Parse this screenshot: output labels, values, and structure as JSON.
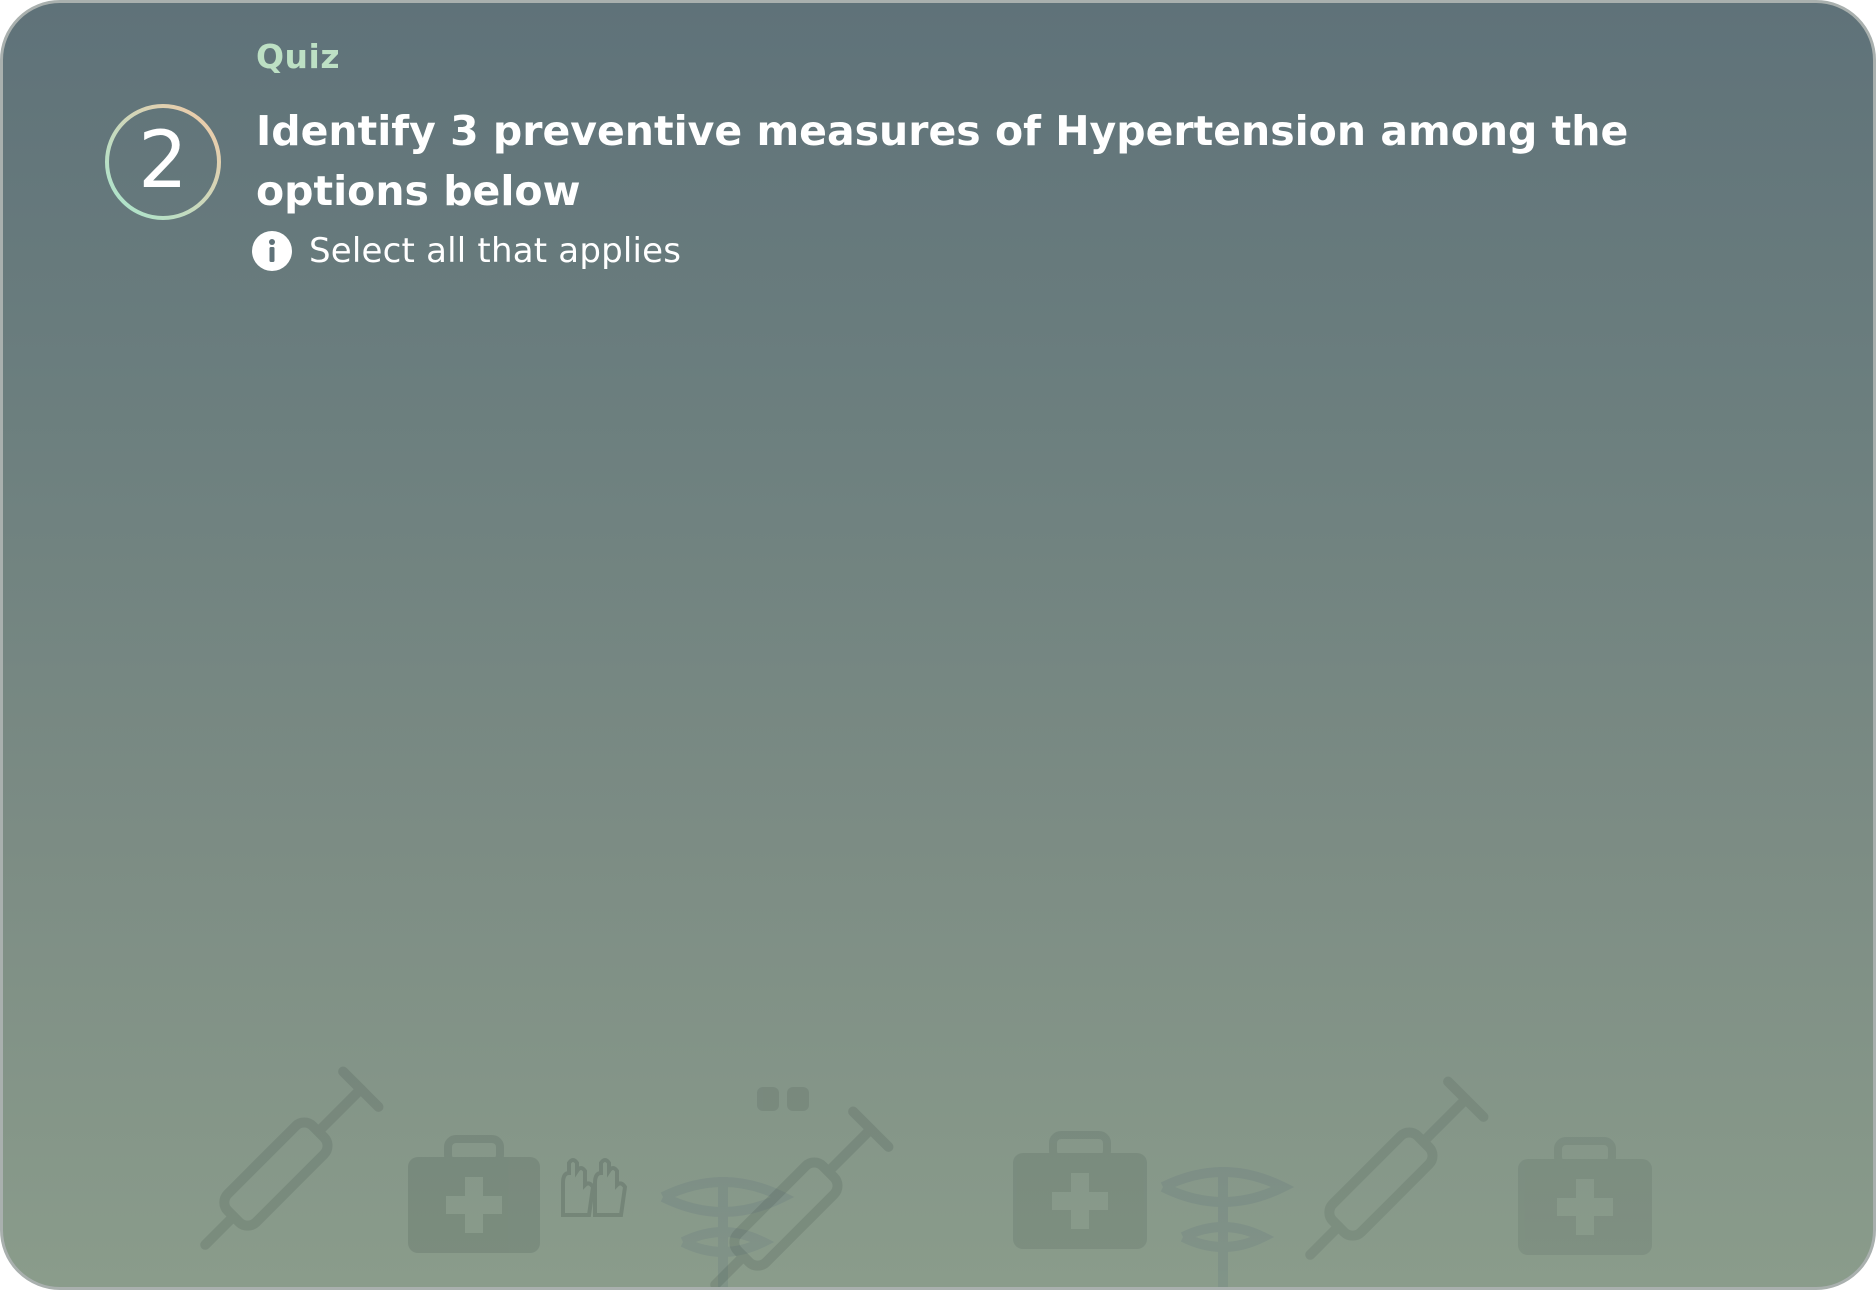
{
  "quiz": {
    "label": "Quiz",
    "question_number": "2",
    "question": "Identify 3 preventive measures of Hypertension among the options below",
    "hint": "Select all that applies"
  },
  "colors": {
    "quiz_label": "#bde0c4",
    "badge_ring_start": "#f3c9a6",
    "badge_ring_end": "#a6e6cf",
    "text": "#ffffff"
  },
  "icons": {
    "info": "info-icon",
    "decor": [
      "syringe-icon",
      "medical-bag-icon",
      "gloves-icon",
      "caduceus-icon"
    ]
  }
}
